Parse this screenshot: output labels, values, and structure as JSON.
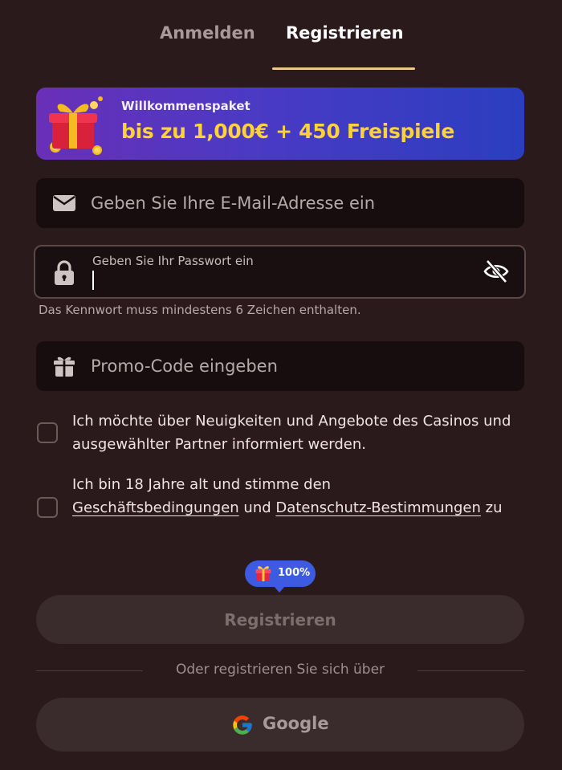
{
  "tabs": {
    "login_label": "Anmelden",
    "register_label": "Registrieren",
    "active": "register"
  },
  "banner": {
    "title": "Willkommenspaket",
    "offer": "bis zu 1,000€ + 450 Freispiele",
    "icon": "gift-icon"
  },
  "email": {
    "placeholder": "Geben Sie Ihre E-Mail-Adresse ein",
    "value": "",
    "icon": "envelope-icon"
  },
  "password": {
    "label": "Geben Sie Ihr Passwort ein",
    "value": "",
    "hint": "Das Kennwort muss mindestens 6 Zeichen enthalten.",
    "icon": "lock-icon",
    "toggle_icon": "eye-off-icon"
  },
  "promo": {
    "placeholder": "Promo-Code eingeben",
    "value": "",
    "icon": "gift-icon"
  },
  "consents": {
    "news": {
      "checked": false,
      "text": "Ich möchte über Neuigkeiten und Angebote des Casinos und ausgewählter Partner informiert werden."
    },
    "age": {
      "checked": false,
      "text_before": "Ich bin 18 Jahre alt und stimme den ",
      "terms_link": "Geschäftsbedingungen",
      "text_middle": " und ",
      "privacy_link": "Datenschutz-Bestimmungen",
      "text_after": " zu"
    }
  },
  "progress_badge": {
    "text": "100%",
    "icon": "gift-icon"
  },
  "register_button": {
    "label": "Registrieren",
    "enabled": false
  },
  "divider": {
    "text": "Oder registrieren Sie sich über"
  },
  "google_button": {
    "label": "Google",
    "icon": "google-icon"
  },
  "colors": {
    "background": "#2b1a1b",
    "field_bg": "#170d0e",
    "accent_tab": "#f2c98a",
    "offer_text": "#ffd23a",
    "badge": "#3d5be0"
  }
}
